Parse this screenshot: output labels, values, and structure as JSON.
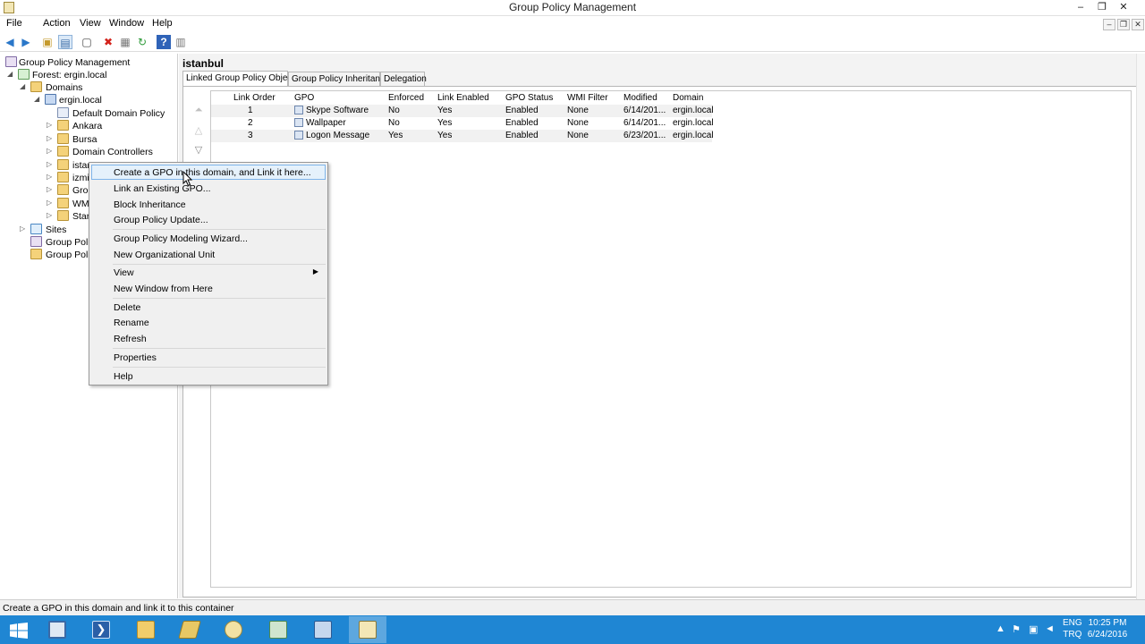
{
  "window": {
    "title": "Group Policy Management",
    "controls": {
      "minimize": "–",
      "restore": "❐",
      "close": "✕"
    }
  },
  "menubar": [
    "File",
    "Action",
    "View",
    "Window",
    "Help"
  ],
  "toolbar": [
    "back-icon",
    "forward-icon",
    "up-folder-icon",
    "show-hide-tree-icon",
    "properties-icon",
    "delete-icon",
    "export-icon",
    "refresh-icon",
    "help-icon",
    "details-icon"
  ],
  "tree": {
    "items": [
      {
        "label": "Group Policy Management",
        "icon": "gpm"
      },
      {
        "label": "Forest: ergin.local",
        "icon": "forest"
      },
      {
        "label": "Domains",
        "icon": "folder"
      },
      {
        "label": "ergin.local",
        "icon": "domain"
      },
      {
        "label": "Default Domain Policy",
        "icon": "gpo"
      },
      {
        "label": "Ankara",
        "icon": "folder"
      },
      {
        "label": "Bursa",
        "icon": "folder"
      },
      {
        "label": "Domain Controllers",
        "icon": "folder"
      },
      {
        "label": "istan",
        "icon": "folder"
      },
      {
        "label": "izmi",
        "icon": "folder"
      },
      {
        "label": "Grou",
        "icon": "folder"
      },
      {
        "label": "WMI",
        "icon": "folder"
      },
      {
        "label": "Start",
        "icon": "folder"
      },
      {
        "label": "Sites",
        "icon": "site"
      },
      {
        "label": "Group Polic",
        "icon": "gpm"
      },
      {
        "label": "Group Polic",
        "icon": "gpm"
      }
    ]
  },
  "details": {
    "heading": "istanbul",
    "tabs": [
      "Linked Group Policy Objects",
      "Group Policy Inheritance",
      "Delegation"
    ],
    "columns": [
      "Link Order",
      "GPO",
      "Enforced",
      "Link Enabled",
      "GPO Status",
      "WMI Filter",
      "Modified",
      "Domain"
    ],
    "rows": [
      {
        "order": "1",
        "gpo": "Skype Software",
        "enforced": "No",
        "link_enabled": "Yes",
        "status": "Enabled",
        "wmi": "None",
        "modified": "6/14/201...",
        "domain": "ergin.local"
      },
      {
        "order": "2",
        "gpo": "Wallpaper",
        "enforced": "No",
        "link_enabled": "Yes",
        "status": "Enabled",
        "wmi": "None",
        "modified": "6/14/201...",
        "domain": "ergin.local"
      },
      {
        "order": "3",
        "gpo": "Logon Message",
        "enforced": "Yes",
        "link_enabled": "Yes",
        "status": "Enabled",
        "wmi": "None",
        "modified": "6/23/201...",
        "domain": "ergin.local"
      }
    ],
    "order_arrows": [
      "⏶",
      "△",
      "▽"
    ]
  },
  "context_menu": {
    "items": [
      "Create a GPO in this domain, and Link it here...",
      "Link an Existing GPO...",
      "Block Inheritance",
      "Group Policy Update...",
      "Group Policy Modeling Wizard...",
      "New Organizational Unit",
      "View",
      "New Window from Here",
      "Delete",
      "Rename",
      "Refresh",
      "Properties",
      "Help"
    ],
    "highlighted": "Create a GPO in this domain, and Link it here..."
  },
  "statusbar": {
    "text": "Create a GPO in this domain and link it to this container"
  },
  "taskbar": {
    "apps": [
      "start-icon",
      "server-manager-icon",
      "powershell-icon",
      "file-explorer-icon",
      "folder-tool-icon",
      "certificate-icon",
      "network-icon",
      "network-admin-icon",
      "group-policy-icon"
    ],
    "lang": [
      "ENG",
      "TRQ"
    ],
    "time": "10:25 PM",
    "date": "6/24/2016",
    "colors": {
      "taskbar": "#1f86d3"
    }
  }
}
